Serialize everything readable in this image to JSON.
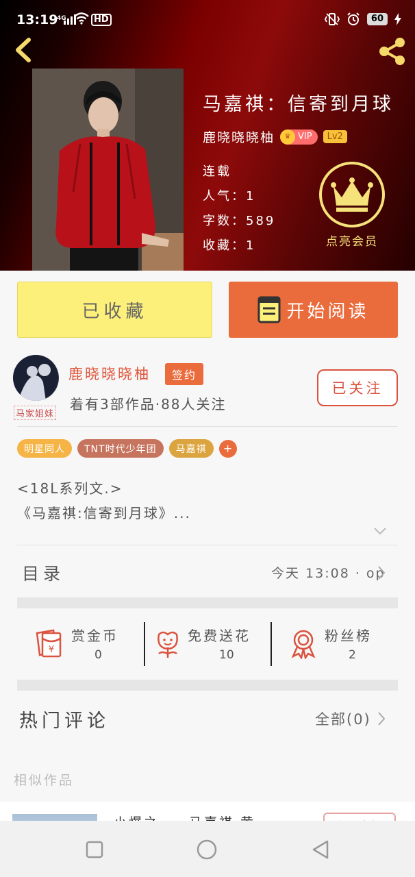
{
  "status_bar": {
    "time": "13:19",
    "network": "4G",
    "hd": "HD",
    "battery": "60"
  },
  "book": {
    "title": "马嘉祺：信寄到月球",
    "author": "鹿晓晓晓柚",
    "vip_label": "VIP",
    "level_label": "Lv2",
    "status": "连载",
    "popularity": "人气：1",
    "words": "字数：589",
    "favorites": "收藏：1",
    "member_label": "点亮会员"
  },
  "actions": {
    "favorite_label": "已收藏",
    "read_label": "开始阅读"
  },
  "author_card": {
    "name": "鹿晓晓晓柚",
    "sign_badge": "签约",
    "stats": "着有3部作品·88人关注",
    "follow_label": "已关注",
    "avatar_caption": "马家姐妹"
  },
  "tags": [
    "明星同人",
    "TNT时代少年团",
    "马嘉祺"
  ],
  "tag_add": "+",
  "intro": {
    "line1": "<18L系列文.>",
    "line2": "《马嘉祺:信寄到月球》..."
  },
  "catalog": {
    "label": "目录",
    "update": "今天 13:08 · op"
  },
  "stats": [
    {
      "label": "赏金币",
      "value": "0",
      "icon": "red-envelope-icon"
    },
    {
      "label": "免费送花",
      "value": "10",
      "icon": "flower-icon"
    },
    {
      "label": "粉丝榜",
      "value": "2",
      "icon": "medal-icon"
    }
  ],
  "comments": {
    "label": "热门评论",
    "all_label": "全部(0)"
  },
  "similar": {
    "label": "相似作品",
    "item_title": "小爆之一，马嘉祺·黄",
    "item_badge": "加入书架"
  },
  "colors": {
    "accent": "#ea6b3c",
    "favorite_bg": "#fdf07a",
    "member_gold": "#f6e27a",
    "author_red": "#e0553b"
  }
}
